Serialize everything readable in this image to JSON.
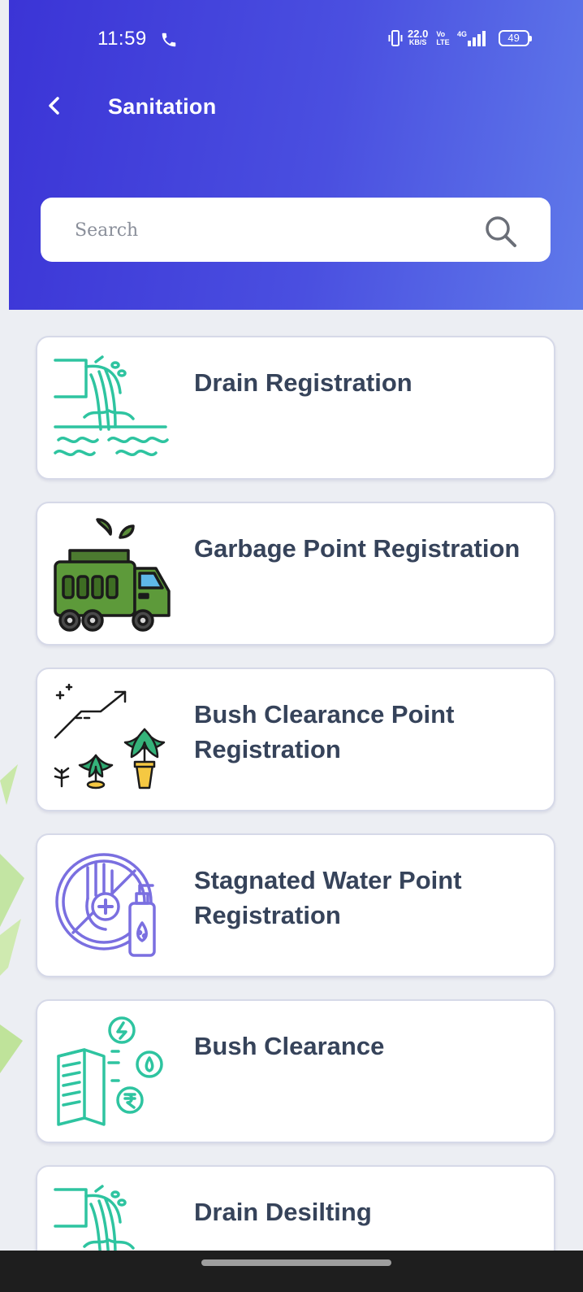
{
  "status_bar": {
    "time": "11:59",
    "net_speed_value": "22.0",
    "net_speed_unit": "KB/S",
    "volte_top": "Vo",
    "volte_bottom": "LTE",
    "network_type": "4G",
    "battery_level": "49"
  },
  "header": {
    "back_icon": "chevron-left-icon",
    "title": "Sanitation"
  },
  "search": {
    "placeholder": "Search",
    "value": "",
    "icon": "search-icon"
  },
  "items": [
    {
      "label": "Drain Registration",
      "icon": "drain-outlet-icon"
    },
    {
      "label": "Garbage Point Registration",
      "icon": "garbage-truck-icon"
    },
    {
      "label": "Bush Clearance Point Registration",
      "icon": "plants-growth-icon"
    },
    {
      "label": "Stagnated Water Point Registration",
      "icon": "hand-sanitizer-icon"
    },
    {
      "label": "Bush Clearance",
      "icon": "book-resources-icon"
    },
    {
      "label": "Drain Desilting",
      "icon": "drain-outlet-icon"
    }
  ],
  "colors": {
    "header_start": "#3b34d6",
    "header_end": "#5f79ea",
    "background": "#eceef3",
    "card_text": "#36435a",
    "teal_icon": "#2ec4a0",
    "purple_icon": "#7a6fe0"
  }
}
